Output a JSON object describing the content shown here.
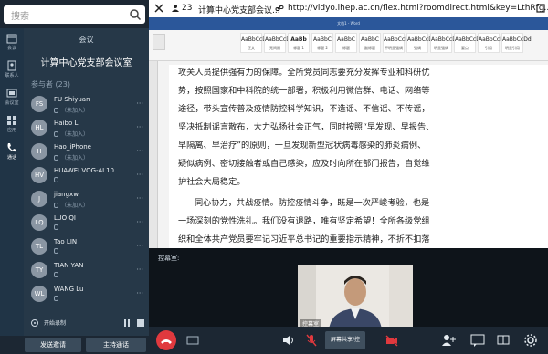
{
  "search": {
    "placeholder": "搜索"
  },
  "rail": {
    "items": [
      {
        "icon": "calendar-icon",
        "label": "会议",
        "active": false
      },
      {
        "icon": "contacts-icon",
        "label": "联系人",
        "active": false
      },
      {
        "icon": "meeting-room-icon",
        "label": "会议室",
        "active": false
      },
      {
        "icon": "apps-icon",
        "label": "应用",
        "active": false
      },
      {
        "icon": "phone-icon",
        "label": "通话",
        "active": true
      }
    ]
  },
  "panel": {
    "header": "会议",
    "room_name": "计算中心党支部会议室",
    "count_label": "参与者 (23)"
  },
  "participants": [
    {
      "initials": "FS",
      "name": "FU Shiyuan",
      "status": "（未加入）"
    },
    {
      "initials": "HL",
      "name": "Haibo Li",
      "status": "（未加入）"
    },
    {
      "initials": "H",
      "name": "Hao_iPhone",
      "status": "（未加入）"
    },
    {
      "initials": "HV",
      "name": "HUAWEI VOG-AL10",
      "status": ""
    },
    {
      "initials": "J",
      "name": "jiangxw",
      "status": "（未加入）"
    },
    {
      "initials": "LQ",
      "name": "LUO QI",
      "status": ""
    },
    {
      "initials": "TL",
      "name": "Tao LIN",
      "status": ""
    },
    {
      "initials": "TY",
      "name": "TIAN YAN",
      "status": ""
    },
    {
      "initials": "WL",
      "name": "WANG Lu",
      "status": ""
    }
  ],
  "recording": {
    "label": "开始录制"
  },
  "bottom_buttons": {
    "invite": "发送邀请",
    "host": "主持通话"
  },
  "titlebar": {
    "count": "23",
    "title": "计算中心党支部会议...",
    "url": "http://vidyo.ihep.ac.cn/flex.html?roomdirect.html&key=LthRfg..."
  },
  "word": {
    "window_title": "文档1 - Word",
    "styles": [
      {
        "sample": "AaBbCcDd",
        "name": "正文"
      },
      {
        "sample": "AaBbCcDd",
        "name": "无间隔"
      },
      {
        "sample": "AaBb",
        "name": "标题 1"
      },
      {
        "sample": "AaBbC",
        "name": "标题 2"
      },
      {
        "sample": "AaBbC",
        "name": "标题"
      },
      {
        "sample": "AaBbC",
        "name": "副标题"
      },
      {
        "sample": "AaBbCcDd",
        "name": "不明显强调"
      },
      {
        "sample": "AaBbCcDd",
        "name": "强调"
      },
      {
        "sample": "AaBbCcDd",
        "name": "明显强调"
      },
      {
        "sample": "AaBbCcDd",
        "name": "要点"
      },
      {
        "sample": "AaBbCcDd",
        "name": "引用"
      },
      {
        "sample": "AaBbCcDd",
        "name": "明显引用"
      }
    ],
    "lines": [
      "攻关人员提供强有力的保障。全所党员同志要充分发挥专业和科研优",
      "势，按照国家和中科院的统一部署，积极利用微信群、电话、网络等",
      "途径，带头宣传普及疫情防控科学知识，不造谣、不信谣、不传谣，",
      "坚决抵制谣言散布，大力弘扬社会正气，同时按照“早发现、早报告、",
      "早隔离、早治疗”的原则，一旦发现新型冠状病毒感染的肺炎病例、",
      "疑似病例、密切接触者或自己感染，应及时向所在部门报告，自觉维",
      "护社会大局稳定。",
      "同心协力，共战疫情。防控疫情斗争，既是一次严峻考验，也是",
      "一场深刻的党性洗礼。我们没有退路，唯有坚定希望！全所各级党组",
      "织和全体共产党员要牢记习近平总书记的重要指示精神，不折不扣落"
    ]
  },
  "video": {
    "speaker_label": "控幕室:",
    "tile_label": "控幕室"
  },
  "controls": {
    "share_label": "屏幕共享/控",
    "hangup_color": "#e0393e"
  },
  "colors": {
    "accent": "#2b579a",
    "panel": "#263848",
    "rail": "#203446"
  }
}
